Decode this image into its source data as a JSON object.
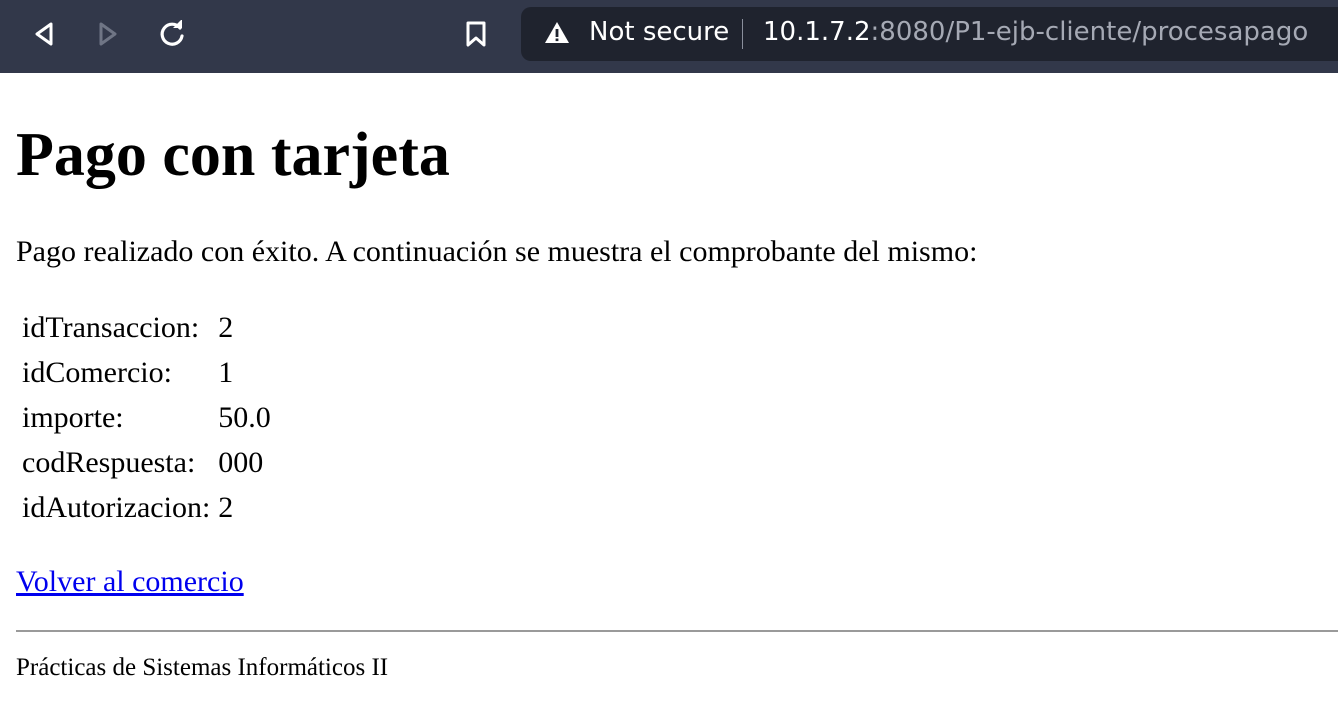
{
  "browser": {
    "security_label": "Not secure",
    "url_host": "10.1.7.2",
    "url_rest": ":8080/P1-ejb-cliente/procesapago",
    "icons": [
      "back-icon",
      "forward-icon",
      "reload-icon",
      "bookmark-icon",
      "warning-icon"
    ]
  },
  "page": {
    "title": "Pago con tarjeta",
    "message": "Pago realizado con éxito. A continuación se muestra el comprobante del mismo:",
    "receipt": [
      {
        "key": "idTransaccion:",
        "value": "2"
      },
      {
        "key": "idComercio:",
        "value": "1"
      },
      {
        "key": "importe:",
        "value": "50.0"
      },
      {
        "key": "codRespuesta:",
        "value": "000"
      },
      {
        "key": "idAutorizacion:",
        "value": "2"
      }
    ],
    "back_link": "Volver al comercio",
    "footer": "Prácticas de Sistemas Informáticos II"
  }
}
